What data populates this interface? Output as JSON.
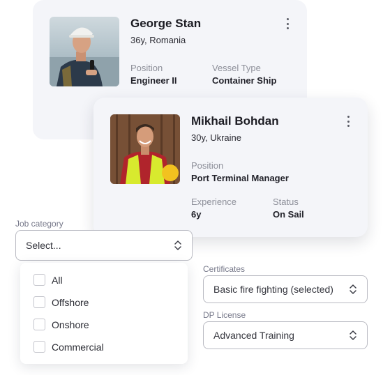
{
  "profiles": [
    {
      "name": "George Stan",
      "subtitle": "36y, Romania",
      "fields": [
        {
          "label": "Position",
          "value": "Engineer II"
        },
        {
          "label": "Vessel Type",
          "value": "Container Ship"
        }
      ]
    },
    {
      "name": "Mikhail Bohdan",
      "subtitle": "30y, Ukraine",
      "fields": [
        {
          "label": "Position",
          "value": "Port Terminal Manager"
        },
        {
          "label": "Experience",
          "value": "6y"
        },
        {
          "label": "Status",
          "value": "On Sail"
        }
      ]
    }
  ],
  "job_category": {
    "label": "Job category",
    "placeholder": "Select...",
    "options": [
      "All",
      "Offshore",
      "Onshore",
      "Commercial"
    ]
  },
  "certificates": {
    "label": "Certificates",
    "value": "Basic fire fighting (selected)"
  },
  "dp_license": {
    "label": "DP License",
    "value": "Advanced Training"
  },
  "icons": {
    "menu": "more-vertical-icon",
    "select_arrows": "chevron-up-down-icon",
    "checkbox": "checkbox-unchecked-icon"
  },
  "colors": {
    "card_background": "#f4f5f9",
    "muted_text": "#8d8f99",
    "border": "#b9bac2"
  }
}
